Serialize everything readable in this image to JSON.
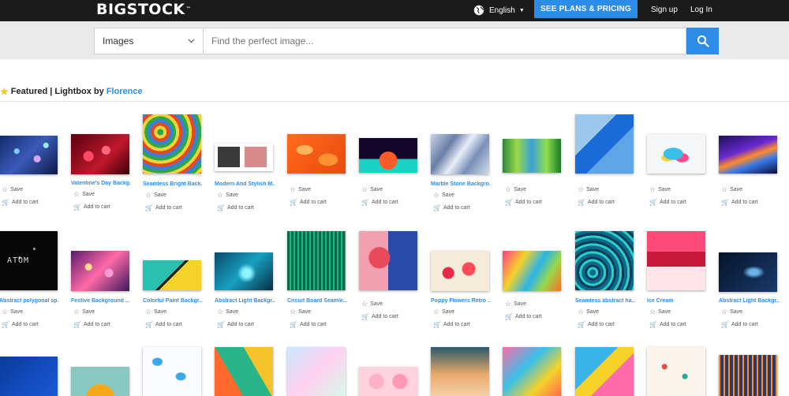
{
  "header": {
    "logo": "BIGSTOCK",
    "logo_mark": "™",
    "language": "English",
    "plans_button": "SEE PLANS & PRICING",
    "signup": "Sign up",
    "login": "Log In"
  },
  "search": {
    "category": "Images",
    "placeholder": "Find the perfect image..."
  },
  "lightbox": {
    "title": "Featured | Lightbox by",
    "owner": "Florence"
  },
  "labels": {
    "save": "Save",
    "add_to_cart": "Add to cart"
  },
  "rows": [
    [
      {
        "title": "",
        "style": "bokeh"
      },
      {
        "title": "Valentine's Day Backg...",
        "style": "hearts"
      },
      {
        "title": "Seamless Bright Back...",
        "style": "circles"
      },
      {
        "title": "Modern And Stylish M...",
        "style": "cards"
      },
      {
        "title": "",
        "style": "orange-leaves"
      },
      {
        "title": "",
        "style": "sunset"
      },
      {
        "title": "Marble Stone Backgro...",
        "style": "marble"
      },
      {
        "title": "",
        "style": "forest"
      },
      {
        "title": "",
        "style": "blue-geo"
      },
      {
        "title": "",
        "style": "splash"
      },
      {
        "title": "",
        "style": "waves"
      }
    ],
    [
      {
        "title": "Abstract polygonal sp...",
        "style": "atom"
      },
      {
        "title": "Festive Background ...",
        "style": "lights"
      },
      {
        "title": "Colorful Paint Backgr...",
        "style": "paint"
      },
      {
        "title": "Abstract Light Backgr...",
        "style": "teal-light"
      },
      {
        "title": "Circuit Board Seamle...",
        "style": "circuit"
      },
      {
        "title": "",
        "style": "patterns"
      },
      {
        "title": "Poppy Flowers Retro ...",
        "style": "poppy"
      },
      {
        "title": "",
        "style": "paint-splash"
      },
      {
        "title": "Seamless abstract ha...",
        "style": "swirl"
      },
      {
        "title": "Ice Cream",
        "style": "ice-cream"
      },
      {
        "title": "Abstract Light Backgr...",
        "style": "dark-light"
      }
    ],
    [
      {
        "title": "",
        "style": "blue-hex"
      },
      {
        "title": "",
        "style": "sunflower"
      },
      {
        "title": "",
        "style": "clouds"
      },
      {
        "title": "",
        "style": "cubes"
      },
      {
        "title": "",
        "style": "scales"
      },
      {
        "title": "",
        "style": "pink-balls"
      },
      {
        "title": "",
        "style": "blur"
      },
      {
        "title": "",
        "style": "watercolor"
      },
      {
        "title": "",
        "style": "triangles"
      },
      {
        "title": "",
        "style": "stars"
      },
      {
        "title": "",
        "style": "orange-lines"
      }
    ]
  ],
  "colors": {
    "accent": "#2d8de6",
    "topbar": "#1b1b1b",
    "search_band": "#eaeaea",
    "star": "#f5c518"
  }
}
